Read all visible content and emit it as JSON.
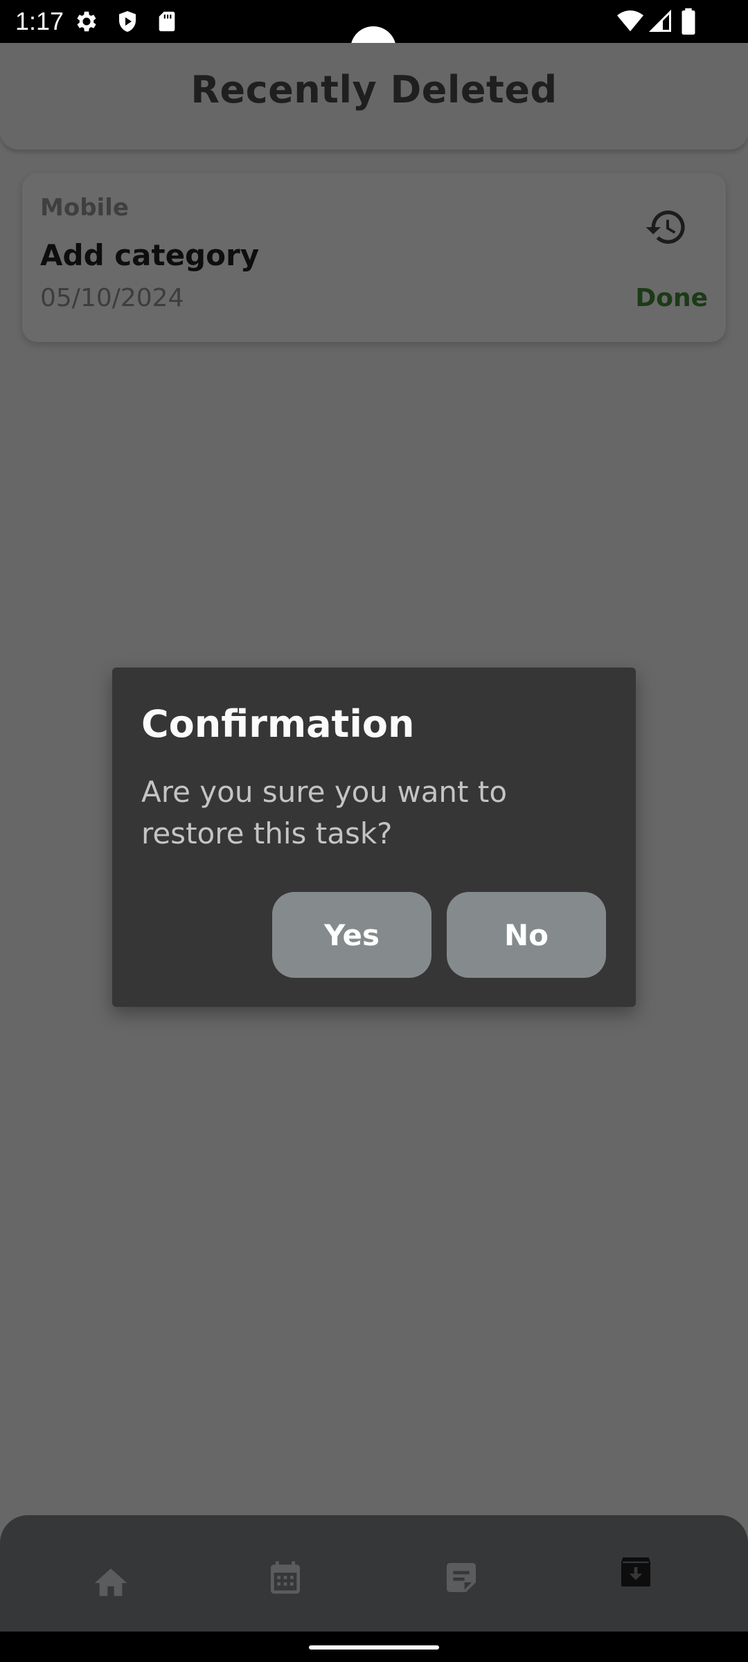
{
  "status_bar": {
    "time": "1:17",
    "left_icons": [
      "settings-icon",
      "shield-play-icon",
      "sd-card-icon"
    ],
    "right_icons": [
      "wifi-icon",
      "cell-signal-icon",
      "battery-icon"
    ]
  },
  "header": {
    "title": "Recently Deleted"
  },
  "tasks": [
    {
      "category": "Mobile",
      "title": "Add category",
      "date": "05/10/2024",
      "status": "Done",
      "status_color": "#1c3a17",
      "action_icon": "restore-history-icon"
    }
  ],
  "dialog": {
    "title": "Confirmation",
    "message": "Are you sure you want to restore this task?",
    "yes_label": "Yes",
    "no_label": "No"
  },
  "bottom_nav": {
    "items": [
      {
        "icon": "home-icon",
        "active": false
      },
      {
        "icon": "calendar-icon",
        "active": false
      },
      {
        "icon": "notes-icon",
        "active": false
      },
      {
        "icon": "archive-icon",
        "active": true
      }
    ]
  },
  "colors": {
    "scrim_background": "#676767",
    "dialog_background": "#363636",
    "dialog_button": "#858b8c",
    "nav_background": "#363738"
  }
}
